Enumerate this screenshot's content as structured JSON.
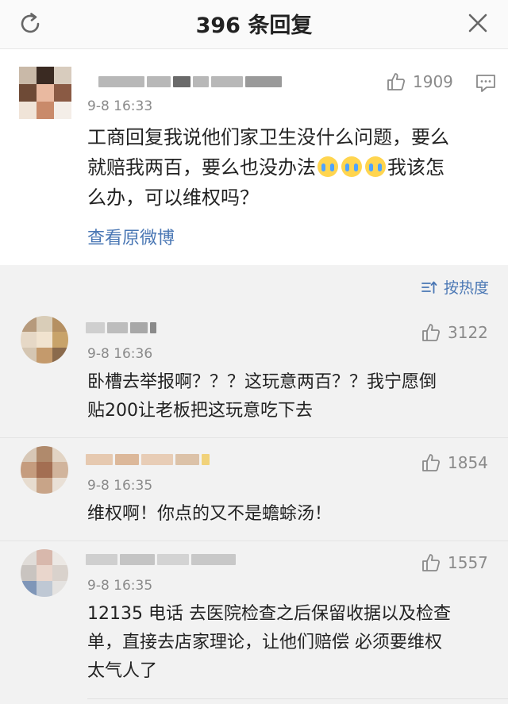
{
  "header": {
    "title": "396 条回复"
  },
  "main_post": {
    "time": "9-8 16:33",
    "likes": "1909",
    "text_line1": "工商回复我说他们家卫生没什么问题，要么",
    "text_line2_a": "就赔我两百，要么也没办法",
    "text_line2_b": "我该怎",
    "text_line3": "么办，可以维权吗？",
    "view_original": "查看原微博"
  },
  "sort_bar": {
    "label": "按热度"
  },
  "comments": [
    {
      "time": "9-8 16:36",
      "likes": "3122",
      "line1": "卧槽去举报啊？？？这玩意两百？？我宁愿倒",
      "line2": "贴200让老板把这玩意吃下去"
    },
    {
      "time": "9-8 16:35",
      "likes": "1854",
      "line1": "维权啊！你点的又不是蟾蜍汤！"
    },
    {
      "time": "9-8 16:35",
      "likes": "1557",
      "line1": "12135 电话 去医院检查之后保留收据以及检查",
      "line2": "单，直接去店家理论，让他们赔偿 必须要维权",
      "line3": "太气人了"
    }
  ],
  "icons": {
    "refresh": "refresh-icon",
    "close": "close-icon",
    "like": "thumbs-up-icon",
    "comment": "comment-icon",
    "sort": "sort-icon",
    "emoji": "crying-face-icon"
  },
  "colors": {
    "link": "#4a77b4",
    "muted": "#8a8a8a",
    "text": "#222222",
    "background": "#f2f2f2"
  }
}
